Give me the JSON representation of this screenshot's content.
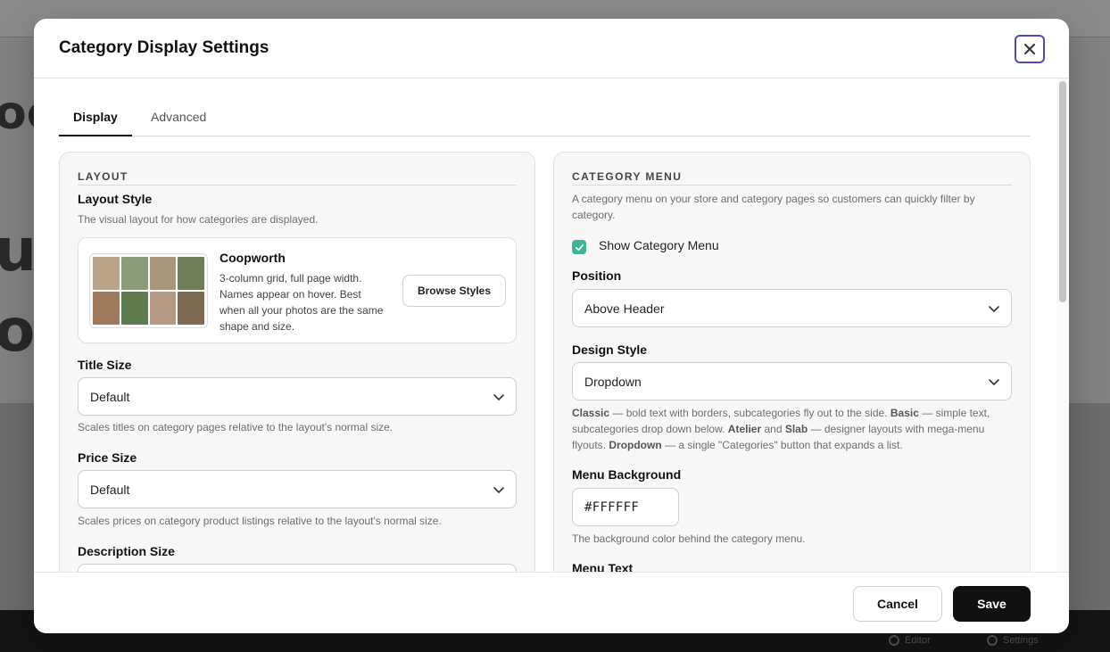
{
  "modal": {
    "title": "Category Display Settings"
  },
  "tabs": [
    {
      "label": "Display",
      "active": true
    },
    {
      "label": "Advanced",
      "active": false
    }
  ],
  "layout": {
    "section_label": "LAYOUT",
    "layout_style": {
      "label": "Layout Style",
      "help": "The visual layout for how categories are displayed.",
      "selected_name": "Coopworth",
      "selected_desc": "3-column grid, full page width. Names appear on hover. Best when all your photos are the same shape and size.",
      "browse_label": "Browse Styles"
    },
    "title_size": {
      "label": "Title Size",
      "value": "Default",
      "help": "Scales titles on category pages relative to the layout's normal size."
    },
    "price_size": {
      "label": "Price Size",
      "value": "Default",
      "help": "Scales prices on category product listings relative to the layout's normal size."
    },
    "description_size": {
      "label": "Description Size"
    }
  },
  "category_menu": {
    "section_label": "CATEGORY MENU",
    "help": "A category menu on your store and category pages so customers can quickly filter by category.",
    "show_menu": {
      "label": "Show Category Menu",
      "checked": true
    },
    "position": {
      "label": "Position",
      "value": "Above Header"
    },
    "design_style": {
      "label": "Design Style",
      "value": "Dropdown",
      "help_parts": {
        "classic": "Classic",
        "classic_text": " — bold text with borders, subcategories fly out to the side. ",
        "basic": "Basic",
        "basic_text": " — simple text, subcategories drop down below. ",
        "atelier": "Atelier",
        "and": " and ",
        "slab": "Slab",
        "slab_text": " — designer layouts with mega-menu flyouts. ",
        "dropdown": "Dropdown",
        "dropdown_text": " — a single \"Categories\" button that expands a list."
      }
    },
    "menu_background": {
      "label": "Menu Background",
      "value": "#FFFFFF",
      "help": "The background color behind the category menu."
    },
    "menu_text": {
      "label": "Menu Text"
    }
  },
  "footer": {
    "cancel_label": "Cancel",
    "save_label": "Save"
  },
  "background_page": {
    "footer_items": [
      "Editor",
      "Settings"
    ]
  },
  "colors": {
    "accent_close_border": "#4e4bb8",
    "checkbox": "#3eb39a",
    "save_button": "#111111"
  }
}
